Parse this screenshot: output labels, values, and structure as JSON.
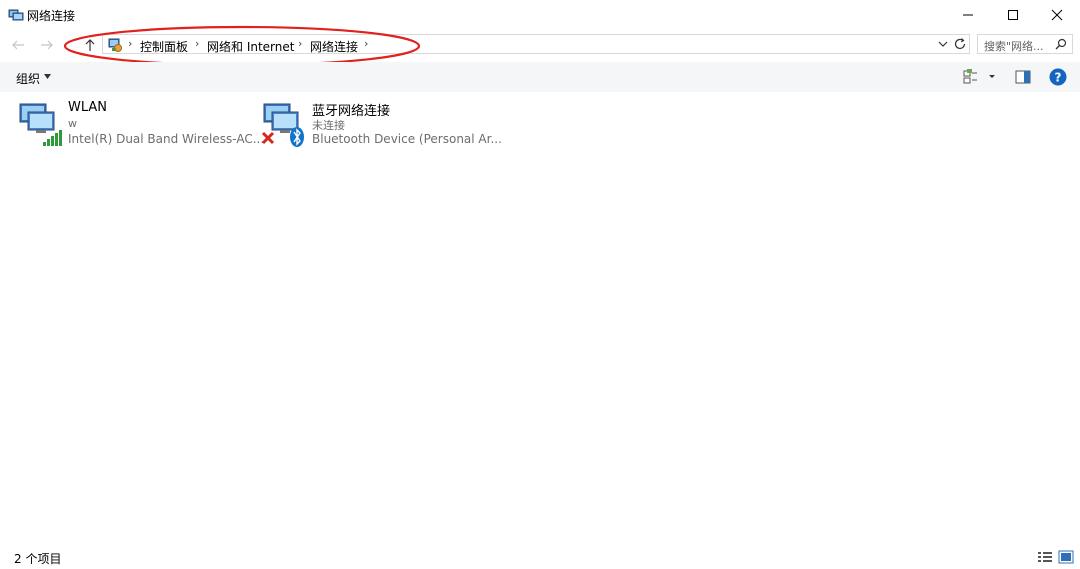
{
  "window": {
    "title": "网络连接"
  },
  "address_bar": {
    "breadcrumbs": [
      "控制面板",
      "网络和 Internet",
      "网络连接"
    ]
  },
  "search": {
    "placeholder": "搜索\"网络..."
  },
  "toolbar": {
    "organize_label": "组织"
  },
  "items": [
    {
      "name": "WLAN",
      "status": "w",
      "device": "Intel(R) Dual Band Wireless-AC...",
      "icon": "wifi-adapter-icon"
    },
    {
      "name": "蓝牙网络连接",
      "status": "未连接",
      "device": "Bluetooth Device (Personal Ar...",
      "icon": "bluetooth-adapter-icon"
    }
  ],
  "statusbar": {
    "count": "2 个项目"
  },
  "colors": {
    "annotation": "#e0211c",
    "signal": "#2e9a3a",
    "error": "#d9261c",
    "bluetooth": "#1274c9",
    "help": "#1565c0"
  }
}
